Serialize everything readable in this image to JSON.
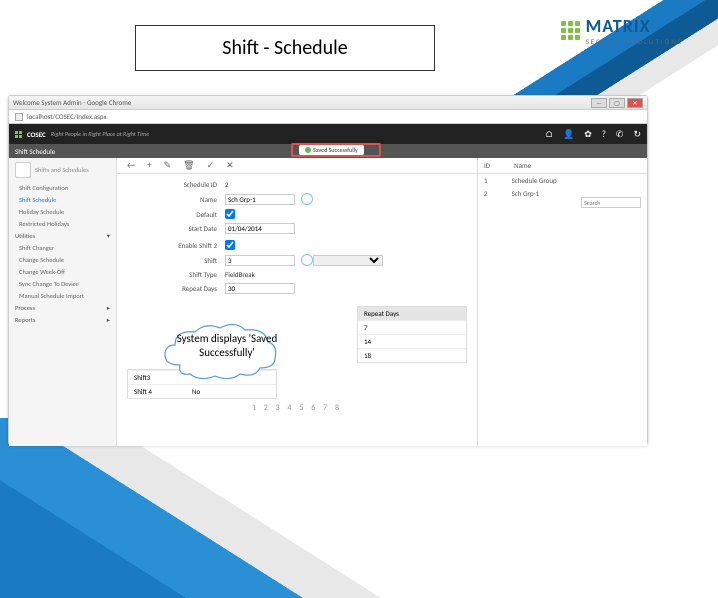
{
  "slide_title": "Shift - Schedule",
  "logo": {
    "brand": "MATRIX",
    "sub": "SECURITY SOLUTIONS"
  },
  "browser": {
    "window_title": "Welcome System Admin - Google Chrome",
    "address": "localhost/COSEC/Index.aspx"
  },
  "app": {
    "brand": "COSEC",
    "tag": "Right People in Right Place at Right Time",
    "icons": {
      "home": "⌂",
      "user": "👤",
      "gear": "✿",
      "help": "?",
      "phone": "✆",
      "refresh": "↻"
    }
  },
  "subheader": {
    "title": "Shift Schedule",
    "saved_msg": "Saved Successfully"
  },
  "sidebar": {
    "group": "Shifts and Schedules",
    "items": [
      "Shift Configuration",
      "Shift Schedule",
      "Holiday Schedule",
      "Restricted Holidays"
    ],
    "utilities_label": "Utilities",
    "util_items": [
      "Shift Changer",
      "Change Schedule",
      "Change Week-Off",
      "Sync Change To Device",
      "Manual Schedule Import"
    ],
    "process_label": "Process",
    "reports_label": "Reports"
  },
  "toolbar": {
    "back": "←",
    "add": "+",
    "edit": "✎",
    "delete": "🗑",
    "save": "✓",
    "cancel": "✕"
  },
  "form": {
    "schedule_id_label": "Schedule ID",
    "schedule_id": "2",
    "name_label": "Name",
    "name": "Sch Grp-1",
    "default_label": "Default",
    "start_date_label": "Start Date",
    "start_date": "01/04/2014",
    "enable_label": "Enable Shift 2",
    "shift_label": "Shift",
    "shift": "3",
    "shift_type_label": "Shift Type",
    "shift_type": "FieldBreak",
    "repeat_label": "Repeat Days",
    "repeat": "30"
  },
  "repeat_table": {
    "head": "Repeat Days",
    "rows": [
      "7",
      "14",
      "18"
    ]
  },
  "shift_table": {
    "rows": [
      {
        "a": "Shift3",
        "b": ""
      },
      {
        "a": "Shift 4",
        "b": "No"
      }
    ]
  },
  "pager": "1 2 3 4 5 6 7 8",
  "right": {
    "h1": "ID",
    "h2": "Name",
    "search": "Search",
    "rows": [
      {
        "id": "1",
        "name": "Schedule Group"
      },
      {
        "id": "2",
        "name": "Sch Grp-1"
      }
    ]
  },
  "cloud_text": "System displays 'Saved Successfully'"
}
